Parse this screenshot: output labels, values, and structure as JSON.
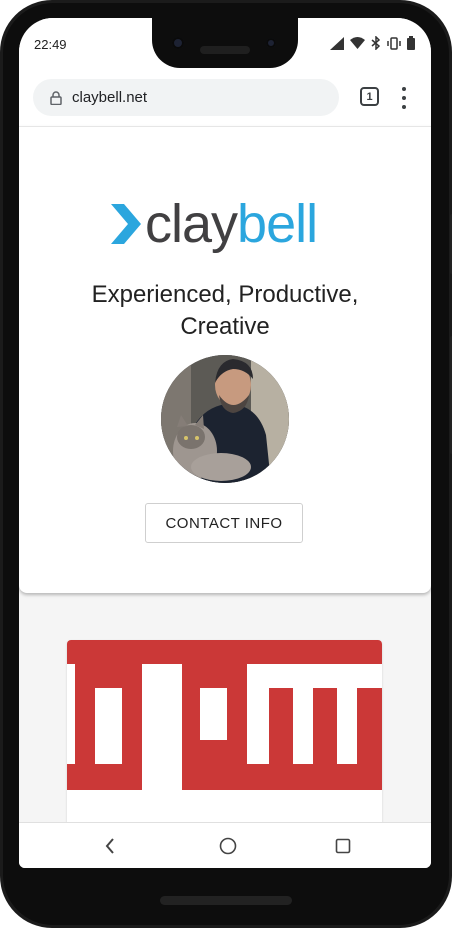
{
  "status": {
    "time": "22:49",
    "icons": [
      "signal-icon",
      "wifi-icon",
      "bluetooth-icon",
      "vibrate-icon",
      "battery-icon"
    ]
  },
  "browser": {
    "url": "claybell.net",
    "tab_count": "1"
  },
  "hero": {
    "logo_part1": "clay",
    "logo_part2": "bell",
    "tagline": "Experienced, Productive, Creative",
    "contact_label": "CONTACT INFO"
  },
  "colors": {
    "brand_blue": "#2ba6de",
    "brand_dark": "#414042",
    "npm_red": "#cb3837"
  },
  "project": {
    "logo_icon": "npm-logo-icon"
  },
  "navigation": {
    "back": "back-icon",
    "home": "home-icon",
    "overview": "overview-icon"
  }
}
